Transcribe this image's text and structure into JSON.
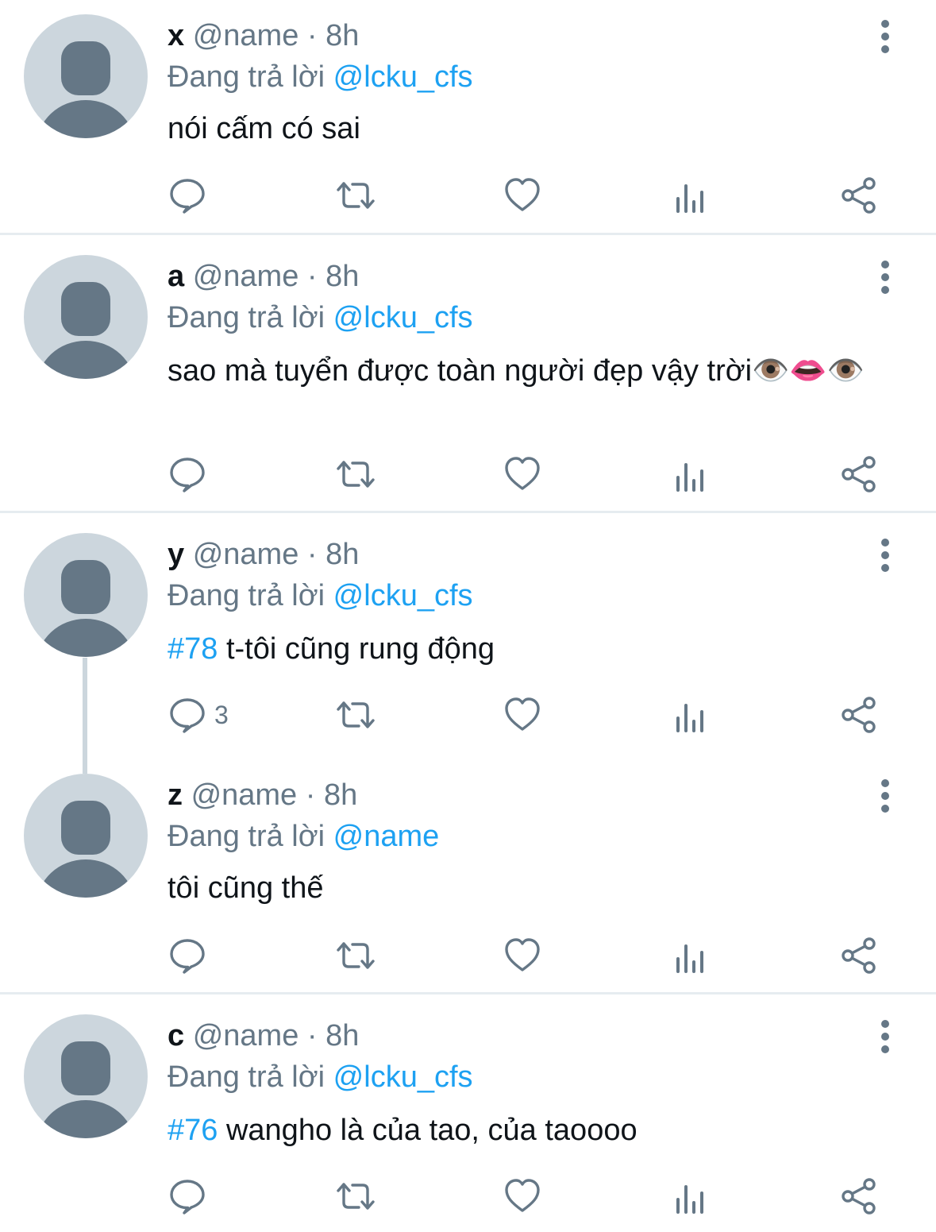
{
  "icons": {
    "reply": "reply-icon",
    "retweet": "retweet-icon",
    "like": "heart-icon",
    "views": "analytics-icon",
    "share": "share-icon",
    "more": "more-vertical-icon",
    "avatar": "default-avatar-icon"
  },
  "colors": {
    "link": "#1da1f2",
    "muted": "#657786",
    "text": "#0f1419",
    "avatar_bg": "#ccd6dd",
    "avatar_fg": "#657786",
    "divider": "#e6ecf0"
  },
  "tweets": [
    {
      "display_name": "x",
      "handle_time": "@name · 8h",
      "reply_prefix": "Đang trả lời",
      "reply_to": "@lcku_cfs",
      "hashtag": "",
      "text": "nói cấm có sai",
      "reply_count": ""
    },
    {
      "display_name": "a",
      "handle_time": "@name · 8h",
      "reply_prefix": "Đang trả lời",
      "reply_to": "@lcku_cfs",
      "hashtag": "",
      "text": "sao mà tuyển được toàn người đẹp vậy trời👁️👄👁️",
      "reply_count": ""
    },
    {
      "display_name": "y",
      "handle_time": "@name · 8h",
      "reply_prefix": "Đang trả lời",
      "reply_to": "@lcku_cfs",
      "hashtag": "#78",
      "text": "t-tôi cũng rung động",
      "reply_count": "3"
    },
    {
      "display_name": "z",
      "handle_time": "@name · 8h",
      "reply_prefix": "Đang trả lời",
      "reply_to": "@name",
      "hashtag": "",
      "text": "tôi cũng thế",
      "reply_count": ""
    },
    {
      "display_name": "c",
      "handle_time": "@name · 8h",
      "reply_prefix": "Đang trả lời",
      "reply_to": "@lcku_cfs",
      "hashtag": "#76",
      "text": "wangho là của tao, của taoooo",
      "reply_count": ""
    }
  ]
}
